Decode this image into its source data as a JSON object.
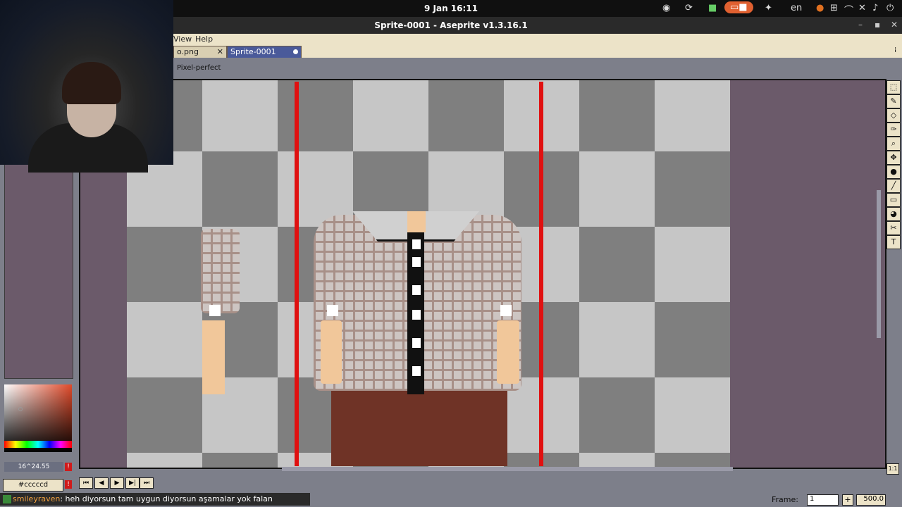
{
  "system_bar": {
    "clock": "9 Jan  16:11",
    "language": "en"
  },
  "window": {
    "title": "Sprite-0001 - Aseprite v1.3.16.1"
  },
  "menu": {
    "view": "View",
    "help": "Help"
  },
  "tabs": [
    {
      "label": "o.png",
      "close": "✕"
    },
    {
      "label": "Sprite-0001"
    }
  ],
  "tool_options": {
    "pixel_perfect": "Pixel-perfect"
  },
  "status": {
    "coords": "16^24.55",
    "hex": "#cccccd"
  },
  "frame": {
    "label": "Frame:",
    "value": "1",
    "zoom": "500.0"
  },
  "chat": {
    "user": "smileyraven",
    "message": ": heh diyorsun tam uygun diyorsun aşamalar yok falan"
  },
  "tools": [
    "marquee-icon",
    "pencil-icon",
    "eraser-icon",
    "eyedropper-icon",
    "zoom-icon",
    "move-icon",
    "fill-icon",
    "line-icon",
    "rectangle-icon",
    "blur-icon",
    "contour-icon",
    "text-icon"
  ],
  "colors": {
    "accent": "#e01010",
    "tab_active": "#4a5a9a",
    "menu_bg": "#ece3c8",
    "canvas_bg": "#6b5a6a"
  }
}
